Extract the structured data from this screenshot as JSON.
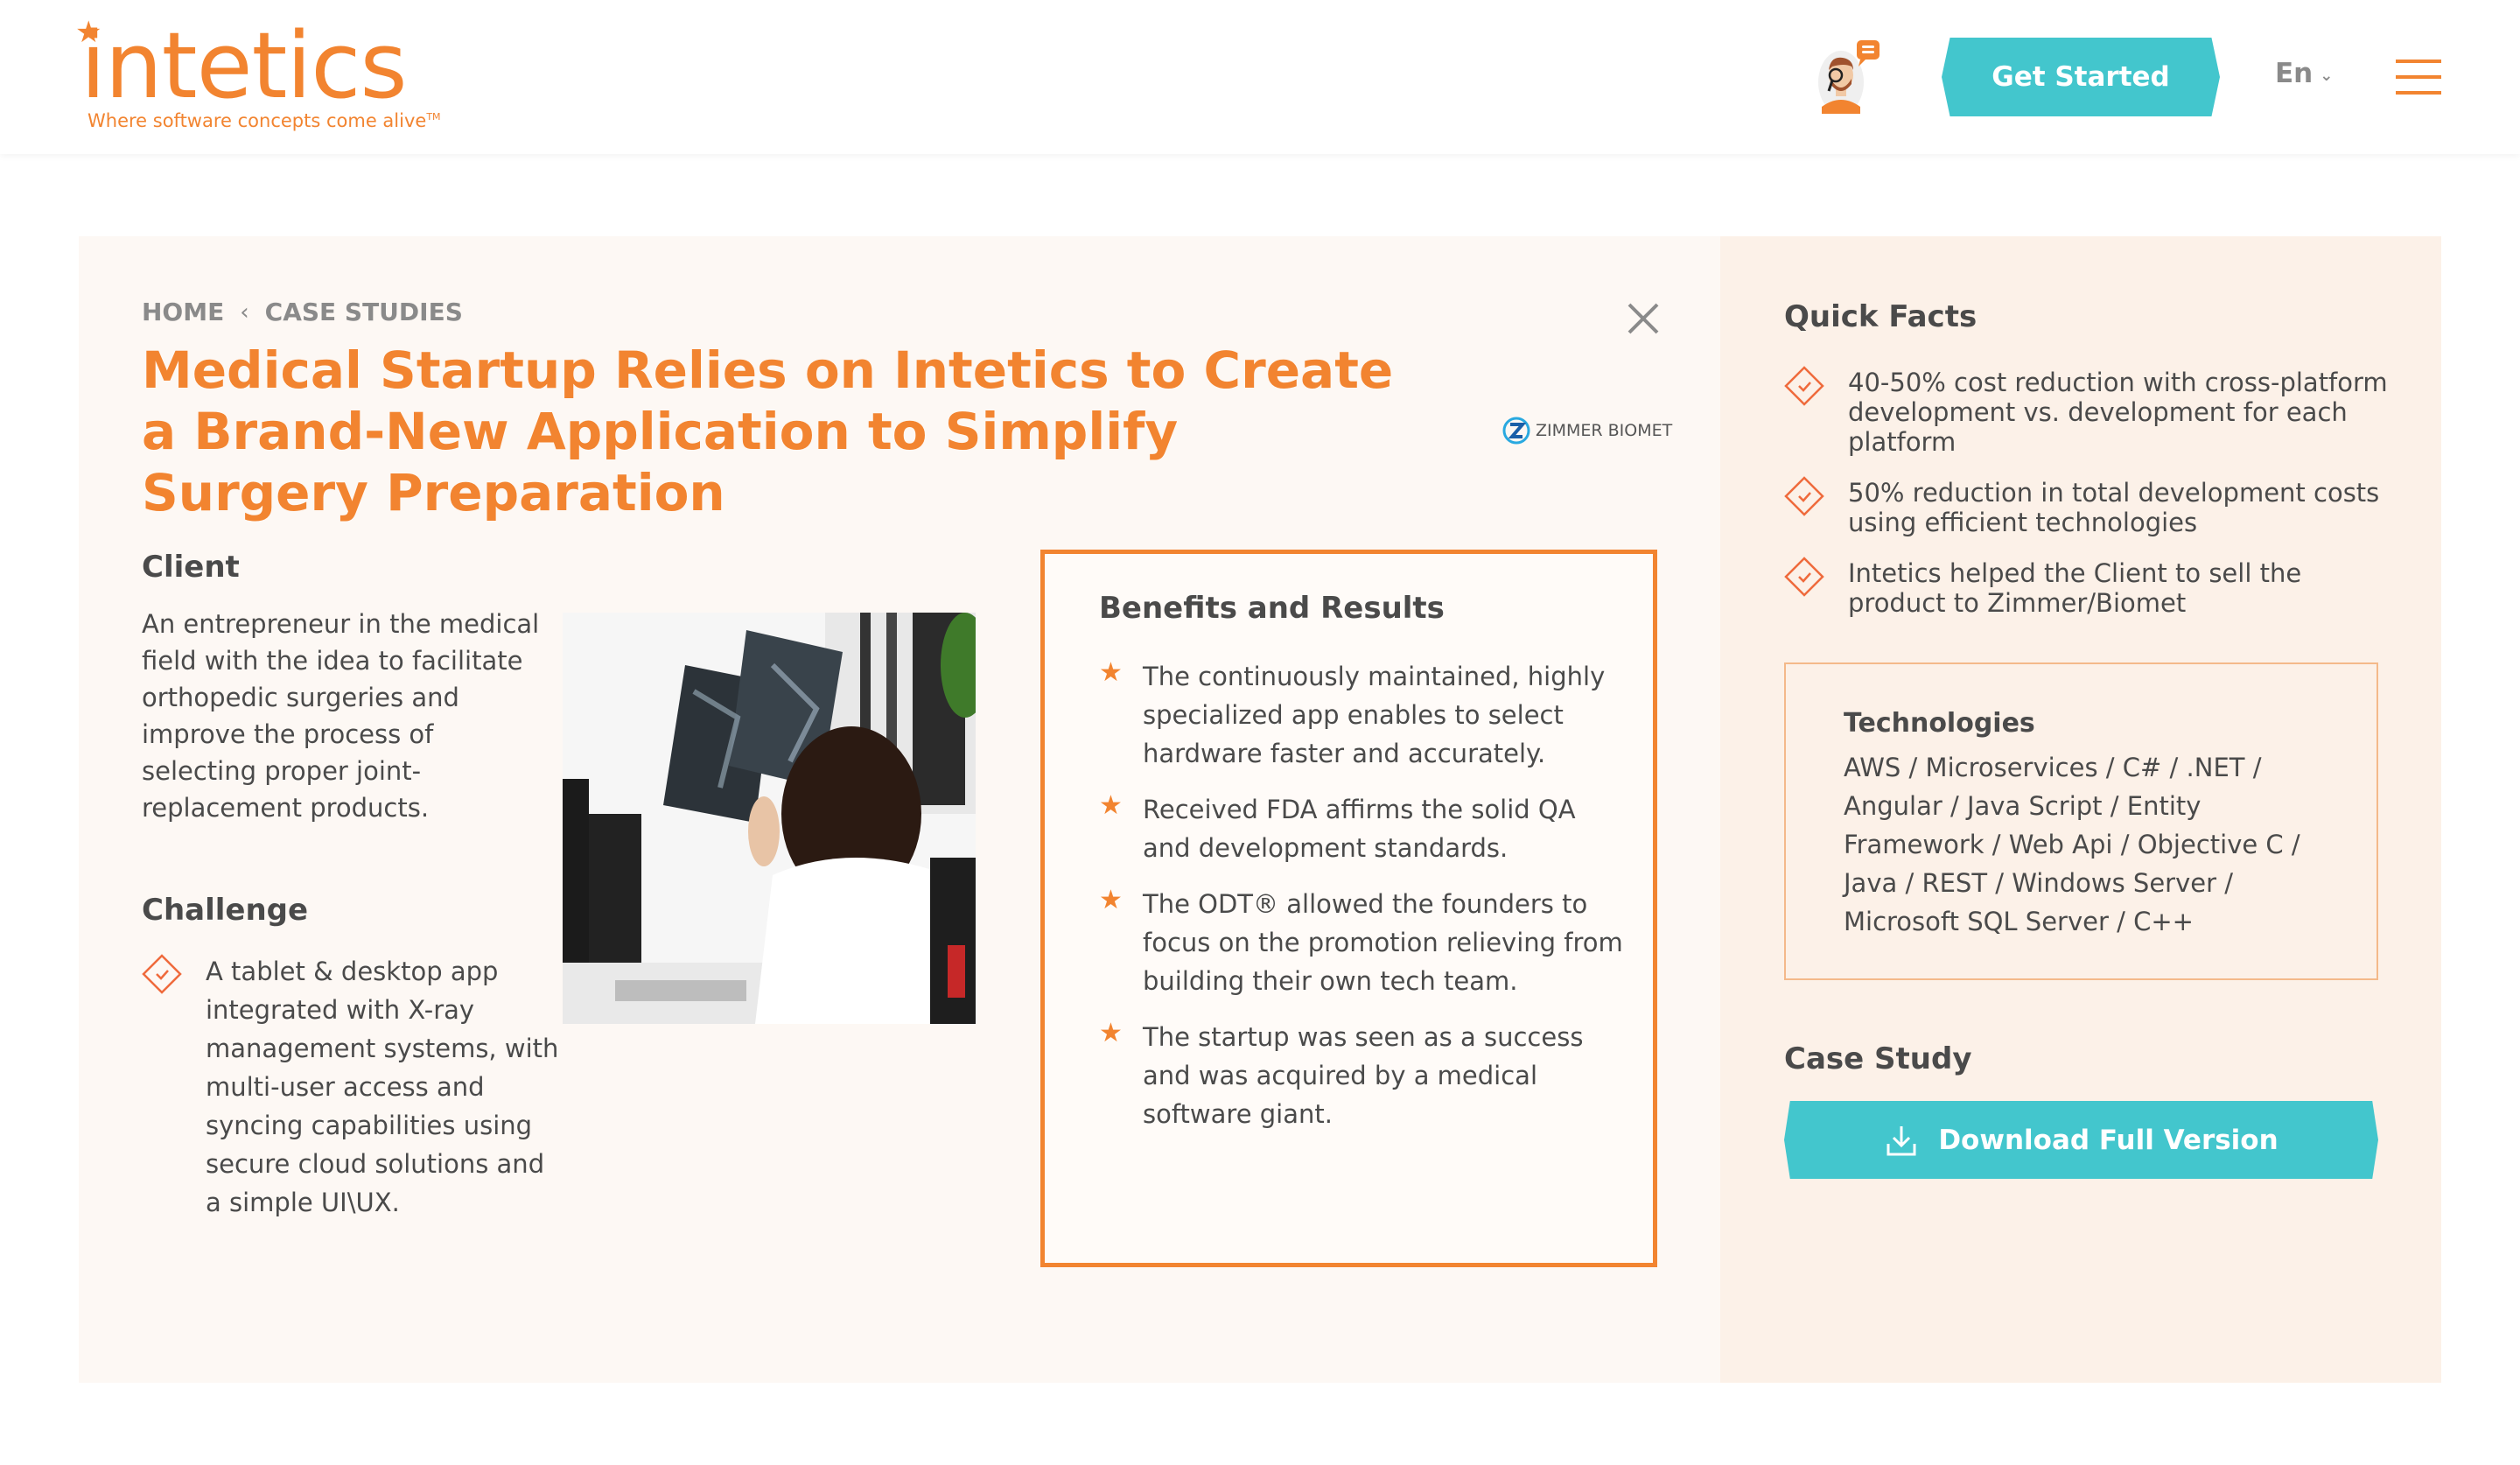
{
  "header": {
    "logo_text": "intetics",
    "logo_tagline": "Where software concepts come alive",
    "logo_tm": "TM",
    "get_started_label": "Get Started",
    "language": "En",
    "colors": {
      "brand_orange": "#f28430",
      "accent_teal": "#43c6cd"
    }
  },
  "breadcrumb": {
    "items": [
      {
        "label": "HOME"
      },
      {
        "label": "CASE STUDIES"
      }
    ],
    "separator_icon": "chevron-left-icon"
  },
  "main": {
    "title": "Medical Startup Relies on Intetics to Create a Brand-New Application to Simplify Surgery Preparation",
    "client_logo_text": "ZIMMER BIOMET",
    "client": {
      "heading": "Client",
      "text": "An entrepreneur in the medical field with the idea to facilitate orthopedic surgeries and improve the process of selecting proper joint-replacement products."
    },
    "challenge": {
      "heading": "Challenge",
      "items": [
        "A tablet & desktop app integrated with X-ray management systems, with multi-user access and syncing capabilities using secure cloud solutions and a simple UI\\UX."
      ]
    },
    "benefits": {
      "heading": "Benefits and Results",
      "items": [
        "The continuously maintained, highly specialized app enables to select hardware faster and accurately.",
        "Received FDA affirms the solid QA and development standards.",
        "The ODT® allowed the founders to focus on the promotion relieving from building their own tech team.",
        "The startup was seen as a success and was acquired by a medical software giant."
      ]
    }
  },
  "sidebar": {
    "quick_facts": {
      "heading": "Quick Facts",
      "items": [
        "40-50% cost reduction with cross-platform development vs. development for each platform",
        "50% reduction in total development costs using efficient technologies",
        "Intetics helped the Client to sell the product to Zimmer/Biomet"
      ]
    },
    "technologies": {
      "heading": "Technologies",
      "text": "AWS / Microservices / C# / .NET / Angular / Java Script / Entity Framework / Web Api / Objective C / Java / REST / Windows Server / Microsoft SQL Server / C++"
    },
    "case_study": {
      "heading": "Case Study",
      "download_label": "Download Full Version"
    }
  }
}
